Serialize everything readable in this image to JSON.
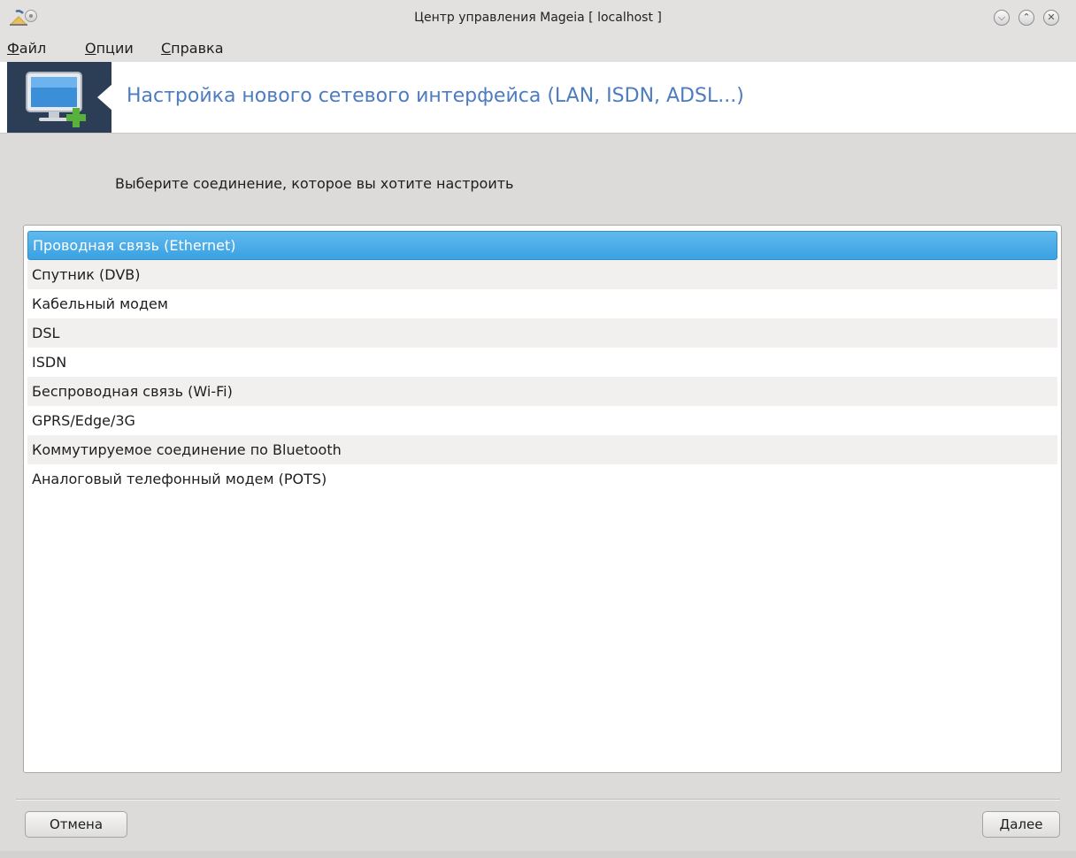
{
  "window": {
    "title": "Центр управления Mageia  [ localhost ]"
  },
  "menubar": {
    "items": [
      {
        "label_underlined": "Ф",
        "label_rest": "айл"
      },
      {
        "label_underlined": "О",
        "label_rest": "пции"
      },
      {
        "label_underlined": "С",
        "label_rest": "правка"
      }
    ]
  },
  "header": {
    "title": "Настройка нового сетевого интерфейса (LAN, ISDN, ADSL...)",
    "icon": "monitor-add-icon"
  },
  "main": {
    "prompt": "Выберите соединение, которое вы хотите настроить",
    "connections": [
      "Проводная связь (Ethernet)",
      "Спутник (DVB)",
      "Кабельный модем",
      "DSL",
      "ISDN",
      "Беспроводная связь (Wi-Fi)",
      "GPRS/Edge/3G",
      "Коммутируемое соединение по Bluetooth",
      "Аналоговый телефонный модем (POTS)"
    ],
    "selected_index": 0
  },
  "footer": {
    "cancel_label": "Отмена",
    "next_label": "Далее"
  },
  "colors": {
    "header_title": "#4d7cc0",
    "selection": "#3ba1e2",
    "header_icon_bg": "#2c3e55"
  }
}
